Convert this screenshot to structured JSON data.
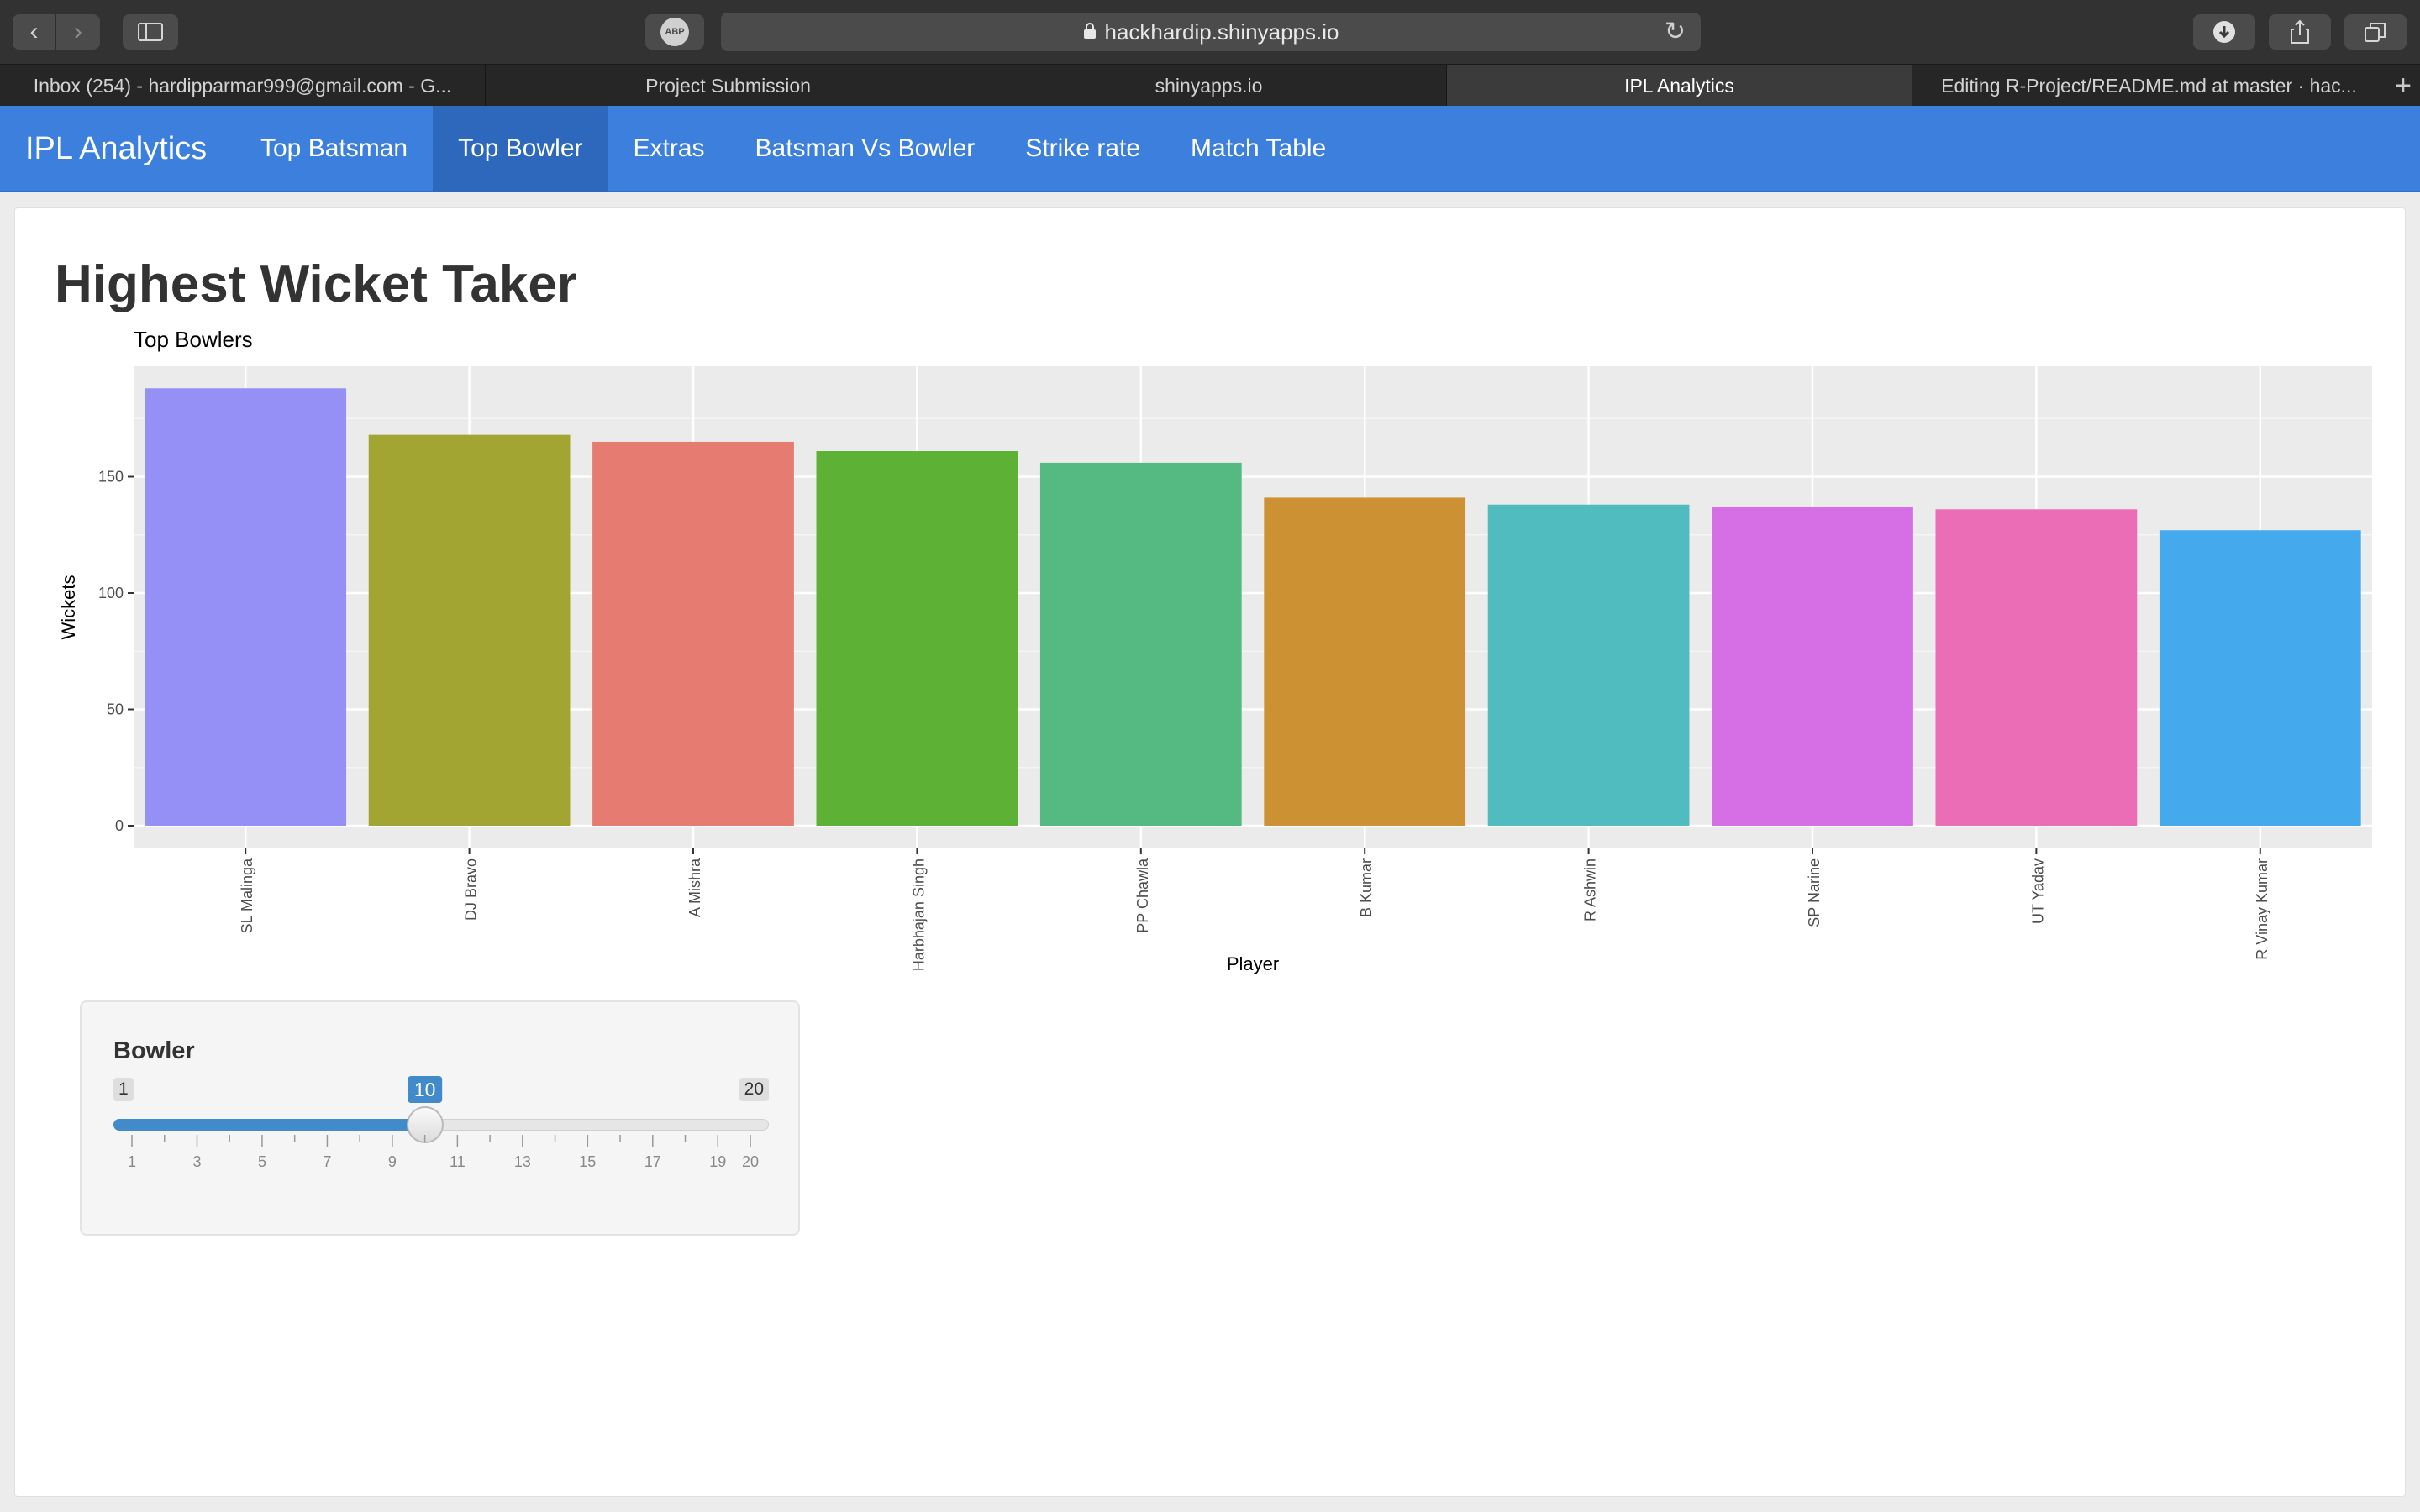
{
  "browser": {
    "url": "hackhardip.shinyapps.io",
    "abp_label": "ABP",
    "tabs": [
      {
        "label": "Inbox (254) - hardipparmar999@gmail.com - G...",
        "active": false
      },
      {
        "label": "Project Submission",
        "active": false
      },
      {
        "label": "shinyapps.io",
        "active": false
      },
      {
        "label": "IPL Analytics",
        "active": true
      },
      {
        "label": "Editing R-Project/README.md at master · hac...",
        "active": false
      }
    ]
  },
  "app": {
    "brand": "IPL Analytics",
    "nav": [
      "Top Batsman",
      "Top Bowler",
      "Extras",
      "Batsman Vs Bowler",
      "Strike rate",
      "Match Table"
    ],
    "active_nav": "Top Bowler"
  },
  "page": {
    "title": "Highest Wicket Taker"
  },
  "chart_data": {
    "type": "bar",
    "title": "Top Bowlers",
    "xlabel": "Player",
    "ylabel": "Wickets",
    "categories": [
      "SL Malinga",
      "DJ Bravo",
      "A Mishra",
      "Harbhajan Singh",
      "PP Chawla",
      "B Kumar",
      "R Ashwin",
      "SP Narine",
      "UT Yadav",
      "R Vinay Kumar"
    ],
    "values": [
      188,
      168,
      165,
      161,
      156,
      141,
      138,
      137,
      136,
      127
    ],
    "colors": [
      "#9590f6",
      "#a3a532",
      "#e67b71",
      "#5db135",
      "#54ba81",
      "#cc9133",
      "#51bcc0",
      "#d66ee5",
      "#eb6db6",
      "#45a9ee"
    ],
    "yticks": [
      0,
      50,
      100,
      150
    ],
    "ylim": [
      0,
      198
    ],
    "background": "#ebebeb",
    "grid": true
  },
  "slider": {
    "label": "Bowler",
    "min": 1,
    "max": 20,
    "value": 10,
    "tick_labels": [
      1,
      3,
      5,
      7,
      9,
      11,
      13,
      15,
      17,
      19,
      20
    ]
  }
}
